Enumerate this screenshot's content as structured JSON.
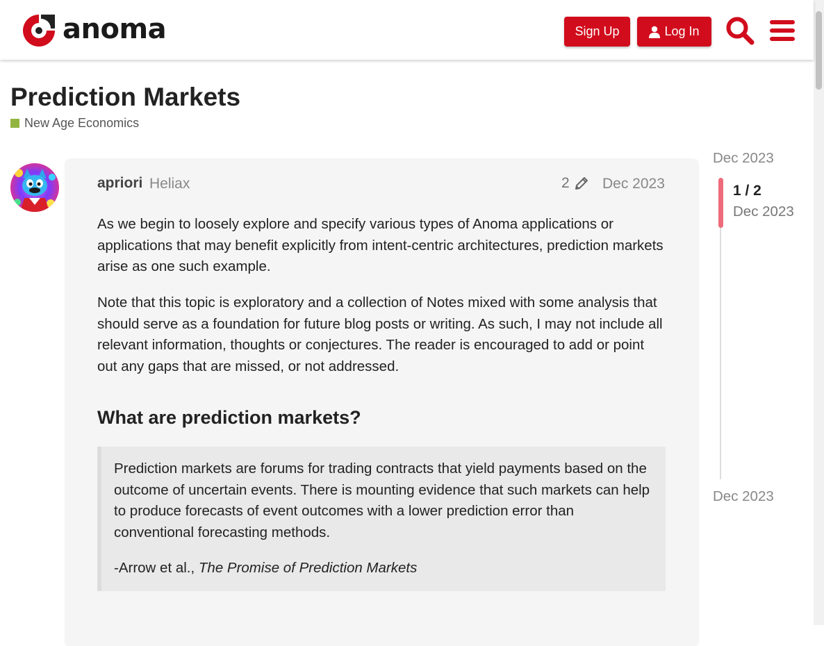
{
  "header": {
    "logo_text": "anoma",
    "signup_label": "Sign Up",
    "login_label": "Log In",
    "search_icon": "search-icon",
    "menu_icon": "hamburger-menu-icon",
    "accent_color": "#d10c1c"
  },
  "topic": {
    "title": "Prediction Markets",
    "category": "New Age Economics",
    "category_color": "#92b541"
  },
  "post": {
    "username": "apriori",
    "org": "Heliax",
    "edit_count": "2",
    "date": "Dec 2023",
    "paragraph1": "As we begin to loosely explore and specify various types of Anoma applications or applications that may benefit explicitly from intent-centric architectures, prediction markets arise as one such example.",
    "paragraph2": "Note that this topic is exploratory and a collection of Notes mixed with some analysis that should serve as a foundation for future blog posts or writing. As such, I may not include all relevant information, thoughts or conjectures. The reader is encouraged to add or point out any gaps that are missed, or not addressed.",
    "heading": "What are prediction markets?",
    "quote_text": "Prediction markets are forums for trading contracts that yield payments based on the outcome of uncertain events. There is mounting evidence that such markets can help to produce forecasts of event outcomes with a lower prediction error than conventional forecasting methods.",
    "quote_attribution_prefix": "-Arrow et al., ",
    "quote_attribution_title": "The Promise of Prediction Markets"
  },
  "timeline": {
    "start_date": "Dec 2023",
    "position": "1 / 2",
    "position_date": "Dec 2023",
    "end_date": "Dec 2023",
    "handle_color": "#ee6b7b"
  }
}
